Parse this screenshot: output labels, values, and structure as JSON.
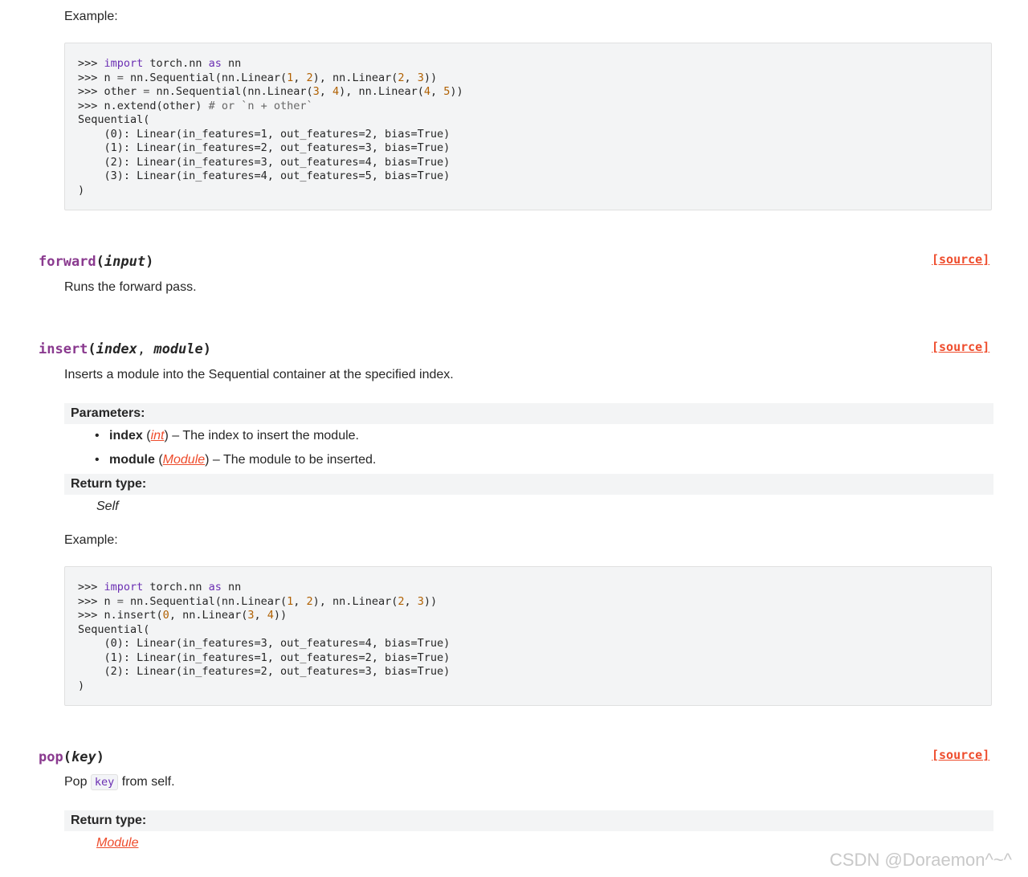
{
  "extend_section": {
    "example_label": "Example:",
    "code_lines": [
      [
        {
          "t": ">>> ",
          "c": ""
        },
        {
          "t": "import",
          "c": "kw"
        },
        {
          "t": " torch.nn ",
          "c": ""
        },
        {
          "t": "as",
          "c": "kw"
        },
        {
          "t": " nn",
          "c": ""
        }
      ],
      [
        {
          "t": ">>> n ",
          "c": ""
        },
        {
          "t": "=",
          "c": "op"
        },
        {
          "t": " nn.Sequential(nn.Linear(",
          "c": ""
        },
        {
          "t": "1",
          "c": "num"
        },
        {
          "t": ", ",
          "c": ""
        },
        {
          "t": "2",
          "c": "num"
        },
        {
          "t": "), nn.Linear(",
          "c": ""
        },
        {
          "t": "2",
          "c": "num"
        },
        {
          "t": ", ",
          "c": ""
        },
        {
          "t": "3",
          "c": "num"
        },
        {
          "t": "))",
          "c": ""
        }
      ],
      [
        {
          "t": ">>> other ",
          "c": ""
        },
        {
          "t": "=",
          "c": "op"
        },
        {
          "t": " nn.Sequential(nn.Linear(",
          "c": ""
        },
        {
          "t": "3",
          "c": "num"
        },
        {
          "t": ", ",
          "c": ""
        },
        {
          "t": "4",
          "c": "num"
        },
        {
          "t": "), nn.Linear(",
          "c": ""
        },
        {
          "t": "4",
          "c": "num"
        },
        {
          "t": ", ",
          "c": ""
        },
        {
          "t": "5",
          "c": "num"
        },
        {
          "t": "))",
          "c": ""
        }
      ],
      [
        {
          "t": ">>> n.extend(other) ",
          "c": ""
        },
        {
          "t": "# or `n + other`",
          "c": "cm"
        }
      ],
      [
        {
          "t": "Sequential(",
          "c": ""
        }
      ],
      [
        {
          "t": "    (0): Linear(in_features=1, out_features=2, bias=True)",
          "c": ""
        }
      ],
      [
        {
          "t": "    (1): Linear(in_features=2, out_features=3, bias=True)",
          "c": ""
        }
      ],
      [
        {
          "t": "    (2): Linear(in_features=3, out_features=4, bias=True)",
          "c": ""
        }
      ],
      [
        {
          "t": "    (3): Linear(in_features=4, out_features=5, bias=True)",
          "c": ""
        }
      ],
      [
        {
          "t": ")",
          "c": ""
        }
      ]
    ]
  },
  "forward": {
    "name": "forward",
    "open_paren": "(",
    "params": "input",
    "close_paren": ")",
    "source_label": "[source]",
    "description": "Runs the forward pass."
  },
  "insert": {
    "name": "insert",
    "open_paren": "(",
    "param1": "index",
    "sep": ", ",
    "param2": "module",
    "close_paren": ")",
    "source_label": "[source]",
    "description": "Inserts a module into the Sequential container at the specified index.",
    "parameters_label": "Parameters:",
    "param_items": [
      {
        "name": "index",
        "open": " (",
        "type": "int",
        "close": ")",
        "desc": " – The index to insert the module."
      },
      {
        "name": "module",
        "open": " (",
        "type": "Module",
        "close": ")",
        "desc": " – The module to be inserted."
      }
    ],
    "return_type_label": "Return type:",
    "return_type": "Self",
    "example_label": "Example:",
    "code_lines": [
      [
        {
          "t": ">>> ",
          "c": ""
        },
        {
          "t": "import",
          "c": "kw"
        },
        {
          "t": " torch.nn ",
          "c": ""
        },
        {
          "t": "as",
          "c": "kw"
        },
        {
          "t": " nn",
          "c": ""
        }
      ],
      [
        {
          "t": ">>> n ",
          "c": ""
        },
        {
          "t": "=",
          "c": "op"
        },
        {
          "t": " nn.Sequential(nn.Linear(",
          "c": ""
        },
        {
          "t": "1",
          "c": "num"
        },
        {
          "t": ", ",
          "c": ""
        },
        {
          "t": "2",
          "c": "num"
        },
        {
          "t": "), nn.Linear(",
          "c": ""
        },
        {
          "t": "2",
          "c": "num"
        },
        {
          "t": ", ",
          "c": ""
        },
        {
          "t": "3",
          "c": "num"
        },
        {
          "t": "))",
          "c": ""
        }
      ],
      [
        {
          "t": ">>> n.insert(",
          "c": ""
        },
        {
          "t": "0",
          "c": "num"
        },
        {
          "t": ", nn.Linear(",
          "c": ""
        },
        {
          "t": "3",
          "c": "num"
        },
        {
          "t": ", ",
          "c": ""
        },
        {
          "t": "4",
          "c": "num"
        },
        {
          "t": "))",
          "c": ""
        }
      ],
      [
        {
          "t": "Sequential(",
          "c": ""
        }
      ],
      [
        {
          "t": "    (0): Linear(in_features=3, out_features=4, bias=True)",
          "c": ""
        }
      ],
      [
        {
          "t": "    (1): Linear(in_features=1, out_features=2, bias=True)",
          "c": ""
        }
      ],
      [
        {
          "t": "    (2): Linear(in_features=2, out_features=3, bias=True)",
          "c": ""
        }
      ],
      [
        {
          "t": ")",
          "c": ""
        }
      ]
    ]
  },
  "pop": {
    "name": "pop",
    "open_paren": "(",
    "params": "key",
    "close_paren": ")",
    "source_label": "[source]",
    "desc_before": "Pop ",
    "desc_code": "key",
    "desc_after": " from self.",
    "return_type_label": "Return type:",
    "return_type": "Module"
  },
  "watermark": "CSDN @Doraemon^~^"
}
